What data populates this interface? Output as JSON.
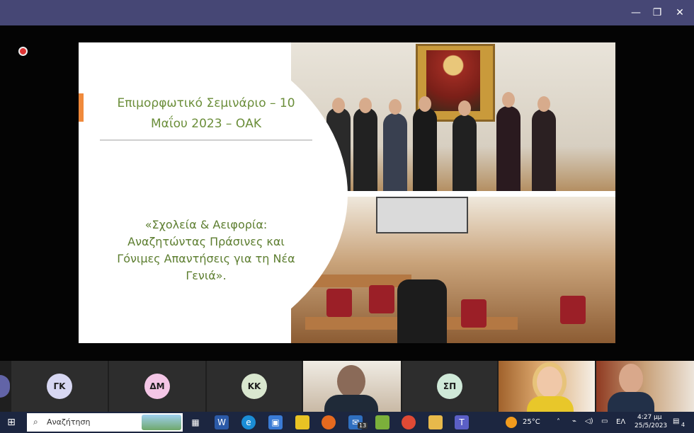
{
  "window": {
    "minimize_icon": "minimize-icon",
    "restore_icon": "restore-icon",
    "close_icon": "close-icon",
    "titlebar_color": "#464775"
  },
  "slide": {
    "title": "Επιμορφωτικό Σεμινάριο – 10 Μαΐου 2023 – ΟΑΚ",
    "body": "«Σχολεία & Αειφορία: Αναζητώντας Πράσινες και Γόνιμες Απαντήσεις για τη Νέα Γενιά».",
    "accent_color": "#f08a3c",
    "text_color": "#6b8e3a"
  },
  "participants": [
    {
      "initials": "ΓΚ",
      "color": "#d7d7f2"
    },
    {
      "initials": "ΔΜ",
      "color": "#f4c6e6"
    },
    {
      "initials": "ΚΚ",
      "color": "#d9e7cf"
    },
    {
      "initials": "ΣΠ",
      "color": "#cfe9d8"
    }
  ],
  "taskbar": {
    "search_placeholder": "Αναζήτηση",
    "weather": "25°C",
    "language": "ΕΛ",
    "time": "4:27 μμ",
    "date": "25/5/2023",
    "mail_badge": "13",
    "notification_count": "4"
  }
}
